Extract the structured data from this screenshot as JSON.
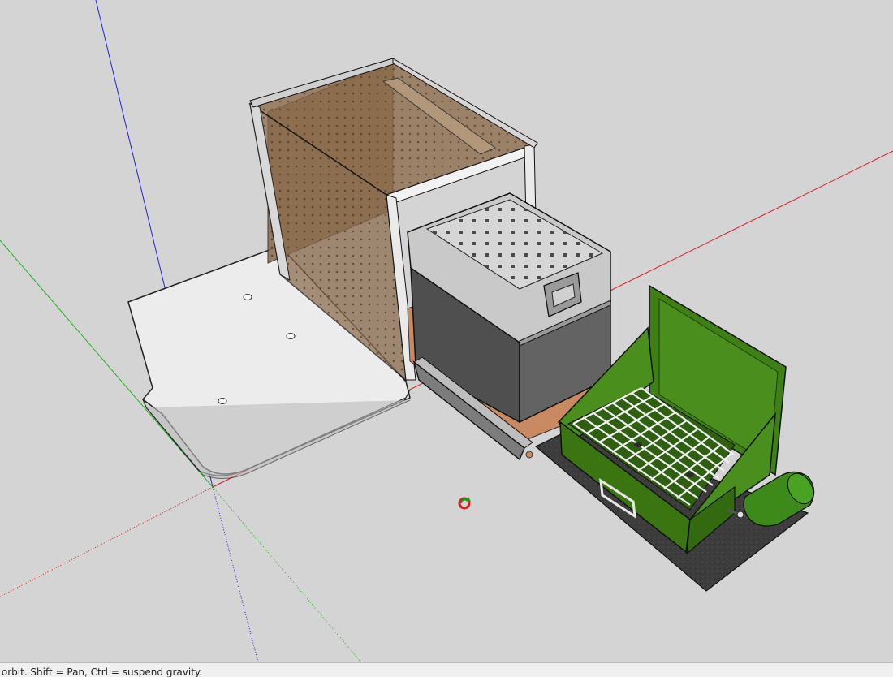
{
  "status_bar": {
    "hint_text": "to orbit. Shift = Pan, Ctrl = suspend gravity."
  },
  "colors": {
    "canvas_background": "#d4d4d4",
    "axis_red": "#e01818",
    "axis_green": "#22b022",
    "axis_blue": "#2020e0",
    "cabinet_tint": "#8b6a4a",
    "cooler_body": "#5c5c5c",
    "cooler_lid": "#c9c9c9",
    "stove_green": "#3f7f16",
    "mat_dark": "#3a3a3a",
    "drawer_wood": "#c98a62"
  },
  "icons": {
    "orbit_cursor": "orbit-cursor-icon"
  }
}
